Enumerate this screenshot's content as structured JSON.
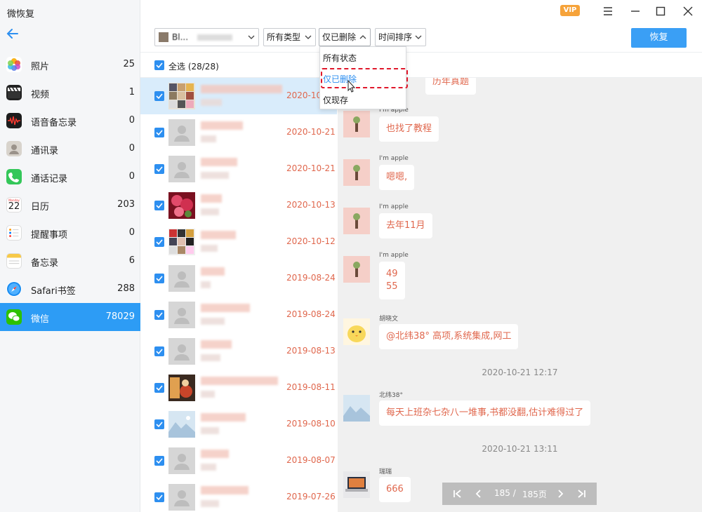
{
  "app": {
    "title": "微恢复",
    "vip_label": "VIP"
  },
  "sidebar": {
    "items": [
      {
        "label": "照片",
        "count": "25"
      },
      {
        "label": "视频",
        "count": "1"
      },
      {
        "label": "语音备忘录",
        "count": "0"
      },
      {
        "label": "通讯录",
        "count": "0"
      },
      {
        "label": "通话记录",
        "count": "0"
      },
      {
        "label": "日历",
        "count": "203",
        "icon_text": "22",
        "icon_sub": "Monday"
      },
      {
        "label": "提醒事项",
        "count": "0"
      },
      {
        "label": "备忘录",
        "count": "6"
      },
      {
        "label": "Safari书签",
        "count": "288"
      },
      {
        "label": "微信",
        "count": "78029",
        "active": true
      }
    ]
  },
  "toolbar": {
    "account": "Bl...",
    "type_filter": "所有类型",
    "status_filter": "仅已删除",
    "sort": "时间排序",
    "restore_label": "恢复"
  },
  "status_menu": {
    "options": [
      "所有状态",
      "仅已删除",
      "仅现存"
    ],
    "selected": "仅已删除"
  },
  "list": {
    "select_all": "全选 (28/28)",
    "rows": [
      {
        "date": "2020-10-",
        "selected": true
      },
      {
        "date": "2020-10-21"
      },
      {
        "date": "2020-10-21"
      },
      {
        "date": "2020-10-13"
      },
      {
        "date": "2020-10-12"
      },
      {
        "date": "2019-08-24"
      },
      {
        "date": "2019-08-24"
      },
      {
        "date": "2019-08-13"
      },
      {
        "date": "2019-08-11"
      },
      {
        "date": "2019-08-10"
      },
      {
        "date": "2019-08-07"
      },
      {
        "date": "2019-07-26"
      }
    ]
  },
  "chat": {
    "top_partial": "历年真题",
    "messages": [
      {
        "sender": "I'm apple",
        "text": "也找了教程"
      },
      {
        "sender": "I'm apple",
        "text": "嗯嗯,"
      },
      {
        "sender": "I'm apple",
        "text": "去年11月"
      },
      {
        "sender": "I'm apple",
        "line1": "49",
        "line2": "55"
      },
      {
        "sender": "胡晓文",
        "text": "@北纬38° 高项,系统集成,网工"
      },
      {
        "timestamp": "2020-10-21 12:17"
      },
      {
        "sender": "北纬38°",
        "text": "每天上班杂七杂八一堆事,书都没翻,估计难得过了"
      },
      {
        "timestamp": "2020-10-21 13:11"
      },
      {
        "sender": "瑞瑞",
        "text": "666"
      }
    ]
  },
  "pager": {
    "current": "185 /",
    "total": "185页"
  }
}
